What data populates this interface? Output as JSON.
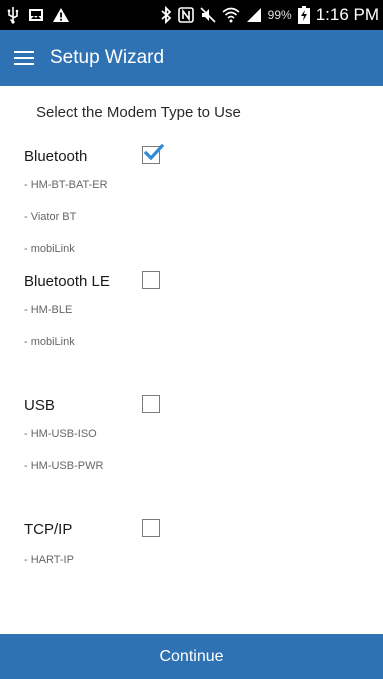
{
  "status_bar": {
    "battery_percent": "99%",
    "time": "1:16 PM",
    "icons": [
      "usb-icon",
      "image-icon",
      "warning-icon",
      "bluetooth-icon",
      "nfc-icon",
      "mute-icon",
      "wifi-icon",
      "signal-icon",
      "battery-charging-icon"
    ]
  },
  "app_bar": {
    "title": "Setup Wizard"
  },
  "instruction": "Select the Modem Type to Use",
  "modem_types": [
    {
      "label": "Bluetooth",
      "checked": true,
      "items": [
        "- HM-BT-BAT-ER",
        "- Viator BT",
        "- mobiLink"
      ]
    },
    {
      "label": "Bluetooth LE",
      "checked": false,
      "items": [
        "- HM-BLE",
        "- mobiLink"
      ]
    },
    {
      "label": "USB",
      "checked": false,
      "items": [
        "- HM-USB-ISO",
        "- HM-USB-PWR"
      ]
    },
    {
      "label": "TCP/IP",
      "checked": false,
      "items": [
        "- HART-IP"
      ]
    }
  ],
  "continue_label": "Continue",
  "colors": {
    "primary": "#2e72b4",
    "check_accent": "#2e8bd8"
  }
}
